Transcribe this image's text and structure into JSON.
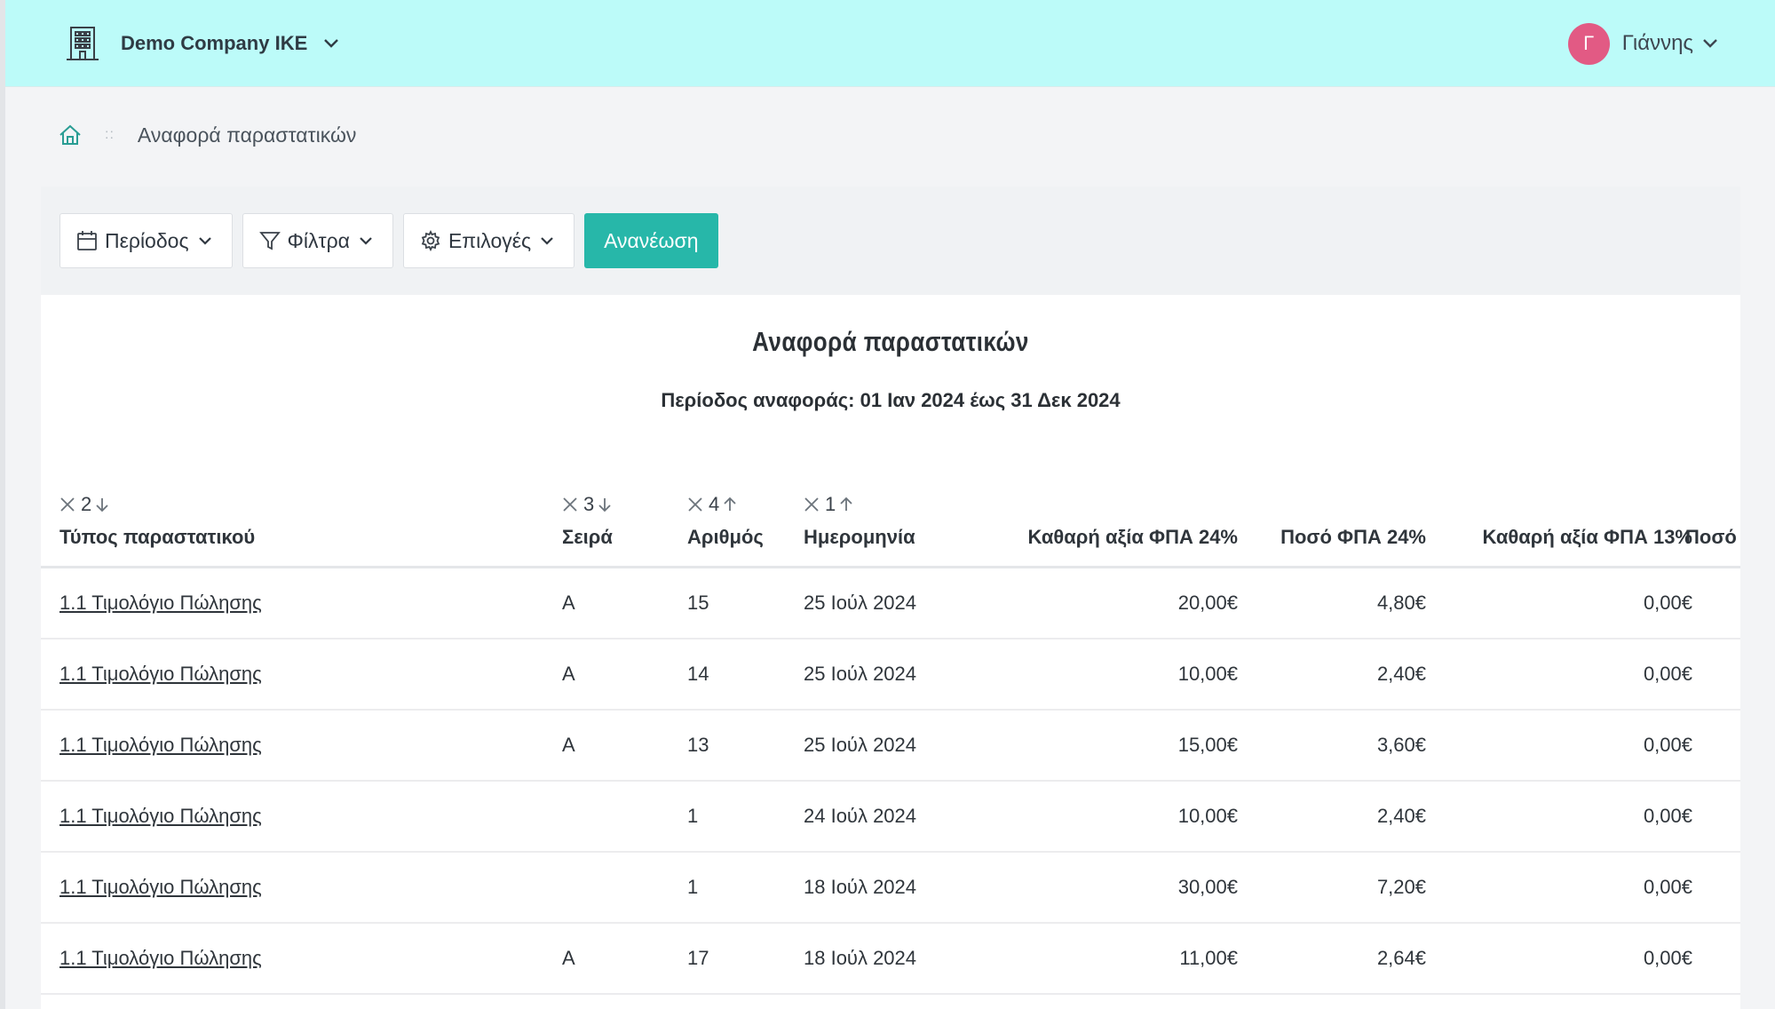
{
  "header": {
    "company_name": "Demo Company IKE",
    "user_initial": "Γ",
    "user_name": "Γιάννης",
    "avatar_color": "#e25a84",
    "topbar_color": "#bcfbf9"
  },
  "breadcrumb": {
    "current": "Αναφορά παραστατικών"
  },
  "toolbar": {
    "period_label": "Περίοδος",
    "filters_label": "Φίλτρα",
    "options_label": "Επιλογές",
    "refresh_label": "Ανανέωση",
    "accent_color": "#27b7a9"
  },
  "report": {
    "title": "Αναφορά παραστατικών",
    "subtitle": "Περίοδος αναφοράς: 01 Ιαν 2024 έως 31 Δεκ 2024"
  },
  "table": {
    "columns": [
      {
        "label": "Τύπος παραστατικού",
        "sort_order": "2",
        "sort_dir": "desc"
      },
      {
        "label": "Σειρά",
        "sort_order": "3",
        "sort_dir": "desc"
      },
      {
        "label": "Αριθμός",
        "sort_order": "4",
        "sort_dir": "asc"
      },
      {
        "label": "Ημερομηνία",
        "sort_order": "1",
        "sort_dir": "asc"
      },
      {
        "label": "Καθαρή αξία ΦΠΑ 24%"
      },
      {
        "label": "Ποσό ΦΠΑ 24%"
      },
      {
        "label": "Καθαρή αξία ΦΠΑ 13%"
      },
      {
        "label": "Ποσό"
      }
    ],
    "rows": [
      {
        "type": "1.1 Τιμολόγιο Πώλησης",
        "series": "Α",
        "number": "15",
        "date": "25 Ιούλ 2024",
        "net24": "20,00€",
        "vat24": "4,80€",
        "net13": "0,00€"
      },
      {
        "type": "1.1 Τιμολόγιο Πώλησης",
        "series": "Α",
        "number": "14",
        "date": "25 Ιούλ 2024",
        "net24": "10,00€",
        "vat24": "2,40€",
        "net13": "0,00€"
      },
      {
        "type": "1.1 Τιμολόγιο Πώλησης",
        "series": "Α",
        "number": "13",
        "date": "25 Ιούλ 2024",
        "net24": "15,00€",
        "vat24": "3,60€",
        "net13": "0,00€"
      },
      {
        "type": "1.1 Τιμολόγιο Πώλησης",
        "series": "",
        "number": "1",
        "date": "24 Ιούλ 2024",
        "net24": "10,00€",
        "vat24": "2,40€",
        "net13": "0,00€"
      },
      {
        "type": "1.1 Τιμολόγιο Πώλησης",
        "series": "",
        "number": "1",
        "date": "18 Ιούλ 2024",
        "net24": "30,00€",
        "vat24": "7,20€",
        "net13": "0,00€"
      },
      {
        "type": "1.1 Τιμολόγιο Πώλησης",
        "series": "Α",
        "number": "17",
        "date": "18 Ιούλ 2024",
        "net24": "11,00€",
        "vat24": "2,64€",
        "net13": "0,00€"
      }
    ]
  }
}
